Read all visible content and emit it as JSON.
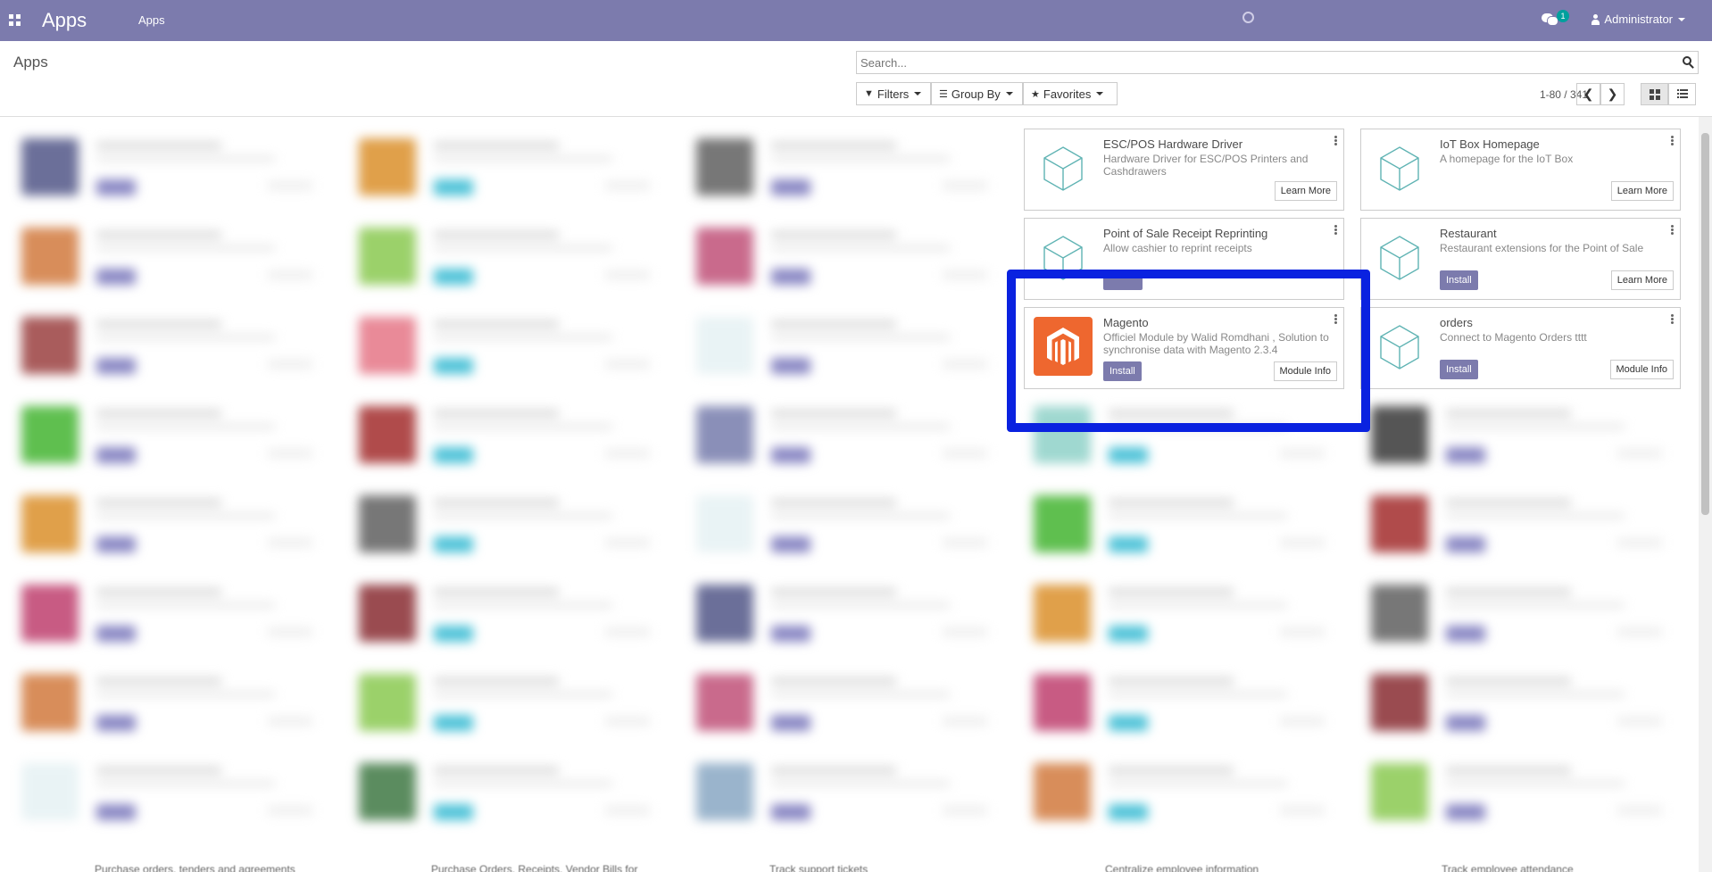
{
  "navbar": {
    "brand": "Apps",
    "menu_item": "Apps",
    "notification_count": "1",
    "user": "Administrator"
  },
  "control_panel": {
    "breadcrumb": "Apps",
    "search_placeholder": "Search...",
    "filters_label": "Filters",
    "group_by_label": "Group By",
    "favorites_label": "Favorites",
    "pager_text": "1-80 / 341"
  },
  "cards": [
    {
      "title": "ESC/POS Hardware Driver",
      "description": "Hardware Driver for ESC/POS Printers and Cashdrawers",
      "primary": "",
      "secondary": "Learn More"
    },
    {
      "title": "IoT Box Homepage",
      "description": "A homepage for the IoT Box",
      "primary": "",
      "secondary": "Learn More"
    },
    {
      "title": "Point of Sale Receipt Reprinting",
      "description": "Allow cashier to reprint receipts",
      "primary": "",
      "secondary": ""
    },
    {
      "title": "Restaurant",
      "description": "Restaurant extensions for the Point of Sale",
      "primary": "Install",
      "secondary": "Learn More"
    },
    {
      "title": "Magento",
      "description": "Officiel Module by Walid Romdhani , Solution to synchronise data with Magento 2.3.4",
      "primary": "Install",
      "secondary": "Module Info"
    },
    {
      "title": "orders",
      "description": "Connect to Magento Orders tttt",
      "primary": "Install",
      "secondary": "Module Info"
    }
  ],
  "blurred_bottom_row": [
    "Purchase orders, tenders and agreements",
    "Purchase Orders, Receipts, Vendor Bills for",
    "Track support tickets",
    "Centralize employee information",
    "Track employee attendance"
  ],
  "colors": {
    "navbar": "#7c7bad",
    "install_button": "#7c7bad",
    "highlight_box": "#0a22e0",
    "magento_orange": "#ee672f"
  }
}
